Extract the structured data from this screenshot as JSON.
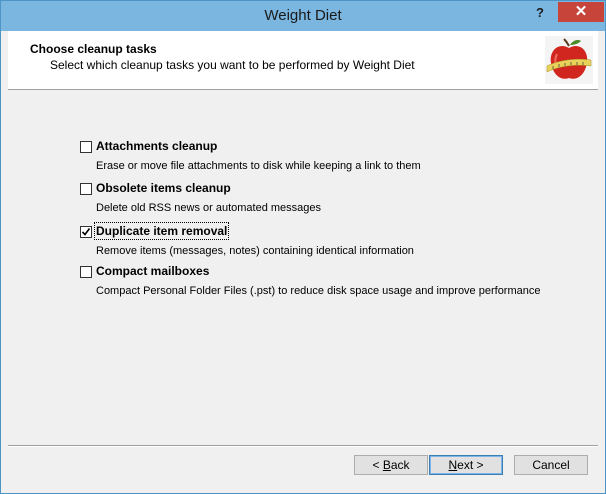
{
  "window": {
    "title": "Weight Diet",
    "help_label": "?",
    "close_label": "✕"
  },
  "header": {
    "title": "Choose cleanup tasks",
    "subtitle": "Select which cleanup tasks you want to be performed by Weight Diet",
    "logo_icon": "apple-measuring-tape-icon"
  },
  "options": [
    {
      "label": "Attachments cleanup",
      "description": "Erase or move file attachments to disk while keeping a link to them",
      "checked": false
    },
    {
      "label": "Obsolete items cleanup",
      "description": "Delete old RSS news or automated messages",
      "checked": false
    },
    {
      "label": "Duplicate item removal",
      "description": "Remove items (messages, notes) containing identical information",
      "checked": true
    },
    {
      "label": "Compact mailboxes",
      "description": "Compact Personal Folder Files (.pst) to reduce disk space usage and improve performance",
      "checked": false
    }
  ],
  "buttons": {
    "back_prefix": "< ",
    "back_mnemonic": "B",
    "back_rest": "ack",
    "next_mnemonic": "N",
    "next_rest": "ext >",
    "cancel": "Cancel"
  },
  "colors": {
    "titlebar": "#7ab6e0",
    "close": "#c7443a",
    "border": "#4d95c7"
  }
}
